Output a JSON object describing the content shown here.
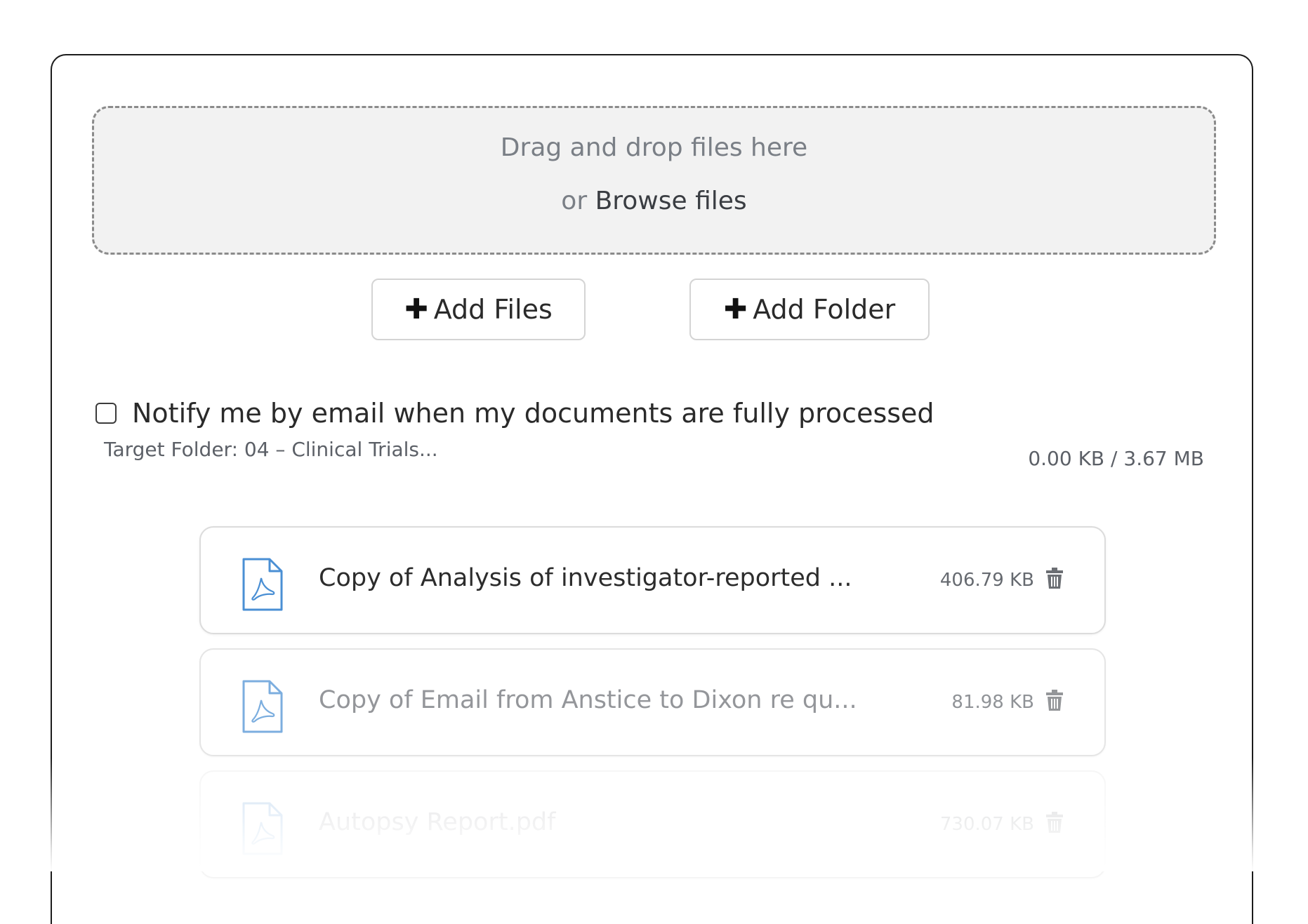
{
  "dropzone": {
    "title": "Drag and drop files here",
    "or_text": "or",
    "browse_label": "Browse files"
  },
  "buttons": {
    "add_files": "Add Files",
    "add_folder": "Add Folder"
  },
  "notify": {
    "label": "Notify me by email when my documents are fully processed",
    "checked": false
  },
  "target_folder": "Target Folder: 04 – Clinical Trials...",
  "total_size": "0.00 KB / 3.67 MB",
  "files": [
    {
      "name": "Copy of Analysis of investigator-reported ...",
      "size": "406.79 KB",
      "icon": "pdf-icon"
    },
    {
      "name": "Copy of Email from Anstice to Dixon re qu...",
      "size": "81.98 KB",
      "icon": "pdf-icon"
    },
    {
      "name": "Autopsy Report.pdf",
      "size": "730.07 KB",
      "icon": "pdf-icon"
    }
  ],
  "colors": {
    "accent_icon": "#4a8fd4",
    "dropzone_bg": "#f2f2f2",
    "dropzone_border": "#8b8b8b"
  }
}
